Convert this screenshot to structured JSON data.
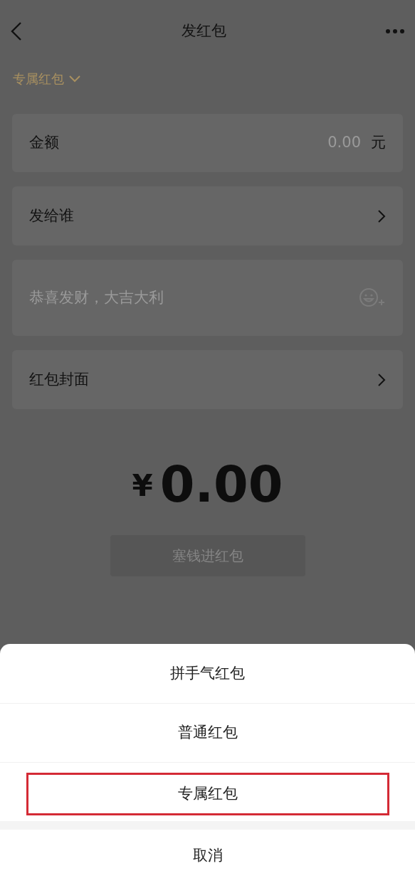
{
  "header": {
    "title": "发红包"
  },
  "type_selector": {
    "label": "专属红包"
  },
  "fields": [
    {
      "kind": "amount",
      "label": "金额",
      "placeholder": "0.00",
      "unit": "元"
    },
    {
      "kind": "link",
      "label": "发给谁"
    },
    {
      "kind": "message",
      "placeholder": "恭喜发财，大吉大利"
    },
    {
      "kind": "link",
      "label": "红包封面"
    }
  ],
  "total": {
    "currency": "¥",
    "amount": "0.00"
  },
  "submit_button": {
    "label": "塞钱进红包",
    "disabled": true
  },
  "action_sheet": {
    "options": [
      {
        "label": "拼手气红包",
        "highlighted": false
      },
      {
        "label": "普通红包",
        "highlighted": false
      },
      {
        "label": "专属红包",
        "highlighted": true
      }
    ],
    "cancel": "取消"
  }
}
